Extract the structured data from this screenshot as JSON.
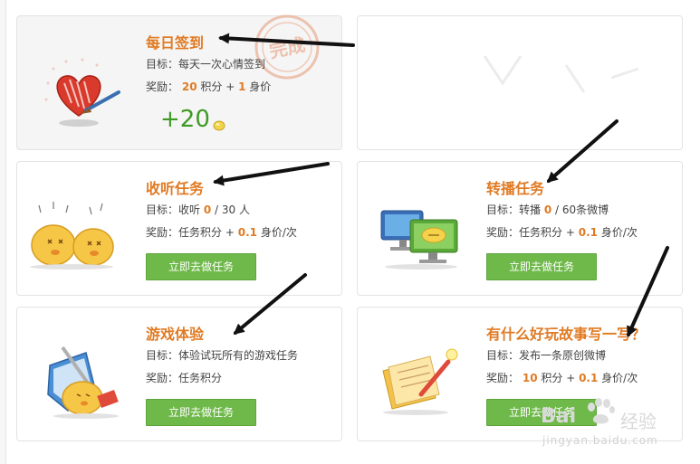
{
  "cards": {
    "signin": {
      "title": "每日签到",
      "goal_prefix": "目标：",
      "goal_text": "每天一次心情签到",
      "reward_prefix": "奖励：",
      "reward_points": "20",
      "reward_points_unit": "积分 +",
      "reward_value": "1",
      "reward_value_unit": "身价",
      "bonus": "+20",
      "stamp_text": "完成"
    },
    "listen": {
      "title": "收听任务",
      "goal_prefix": "目标：",
      "goal_text": "收听",
      "goal_current": "0",
      "goal_total": "/ 30 人",
      "reward_prefix": "奖励：",
      "reward_text": "任务积分 +",
      "reward_value": "0.1",
      "reward_value_unit": "身价/次",
      "button": "立即去做任务"
    },
    "repost": {
      "title": "转播任务",
      "goal_prefix": "目标：",
      "goal_text": "转播",
      "goal_current": "0",
      "goal_total": "/ 60条微博",
      "reward_prefix": "奖励：",
      "reward_text": "任务积分 +",
      "reward_value": "0.1",
      "reward_value_unit": "身价/次",
      "button": "立即去做任务"
    },
    "game": {
      "title": "游戏体验",
      "goal_prefix": "目标：",
      "goal_text": "体验试玩所有的游戏任务",
      "reward_prefix": "奖励：",
      "reward_text": "任务积分",
      "button": "立即去做任务"
    },
    "story": {
      "title": "有什么好玩故事写一写？",
      "goal_prefix": "目标：",
      "goal_text": "发布一条原创微博",
      "reward_prefix": "奖励：",
      "reward_points": "10",
      "reward_points_unit": "积分 +",
      "reward_value": "0.1",
      "reward_value_unit": "身价/次",
      "button": "立即去做任务"
    }
  },
  "watermark": {
    "brand": "Bai",
    "brand_cn": "经验",
    "url": "jingyan.baidu.com"
  },
  "colors": {
    "accent": "#e07b24",
    "button": "#6fb94a",
    "bonus": "#3d9a24"
  }
}
